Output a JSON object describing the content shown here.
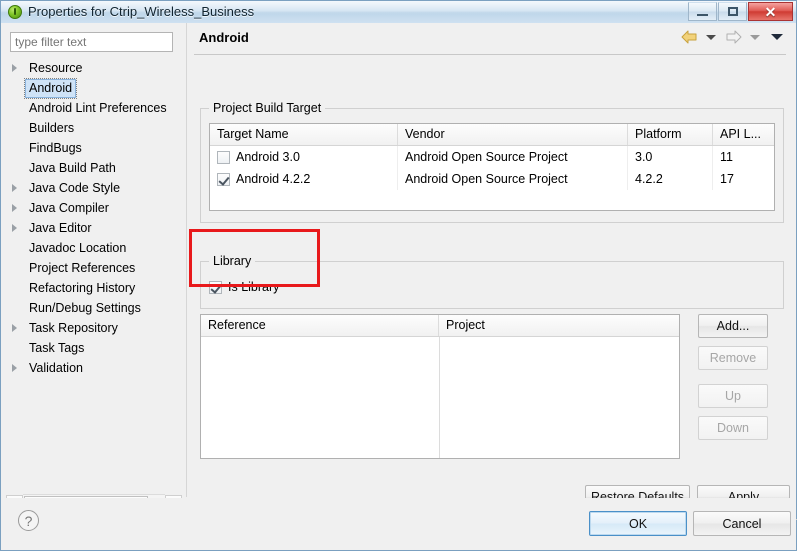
{
  "window": {
    "title": "Properties for Ctrip_Wireless_Business",
    "icon": "eclipse-green-icon",
    "controls": {
      "minimize": "minimize-icon",
      "maximize": "maximize-icon",
      "close": "✕"
    }
  },
  "sidebar": {
    "filter": {
      "value": "",
      "placeholder": "type filter text"
    },
    "items": [
      {
        "label": "Resource",
        "expandable": true,
        "selected": false
      },
      {
        "label": "Android",
        "expandable": false,
        "selected": true
      },
      {
        "label": "Android Lint Preferences",
        "expandable": false,
        "selected": false
      },
      {
        "label": "Builders",
        "expandable": false,
        "selected": false
      },
      {
        "label": "FindBugs",
        "expandable": false,
        "selected": false
      },
      {
        "label": "Java Build Path",
        "expandable": false,
        "selected": false
      },
      {
        "label": "Java Code Style",
        "expandable": true,
        "selected": false
      },
      {
        "label": "Java Compiler",
        "expandable": true,
        "selected": false
      },
      {
        "label": "Java Editor",
        "expandable": true,
        "selected": false
      },
      {
        "label": "Javadoc Location",
        "expandable": false,
        "selected": false
      },
      {
        "label": "Project References",
        "expandable": false,
        "selected": false
      },
      {
        "label": "Refactoring History",
        "expandable": false,
        "selected": false
      },
      {
        "label": "Run/Debug Settings",
        "expandable": false,
        "selected": false
      },
      {
        "label": "Task Repository",
        "expandable": true,
        "selected": false
      },
      {
        "label": "Task Tags",
        "expandable": false,
        "selected": false
      },
      {
        "label": "Validation",
        "expandable": true,
        "selected": false
      }
    ],
    "scrollbar": {
      "left_arrow": "◀",
      "right_arrow": "▶",
      "grip": "❘❘❘"
    }
  },
  "page": {
    "title": "Android",
    "nav": {
      "back": "back-arrow-icon",
      "back_menu": "chevron-down-icon",
      "forward": "forward-arrow-icon",
      "forward_menu": "chevron-down-icon",
      "view_menu": "view-menu-icon"
    }
  },
  "build_target": {
    "group_title": "Project Build Target",
    "columns": [
      "Target Name",
      "Vendor",
      "Platform",
      "API L..."
    ],
    "rows": [
      {
        "checked": false,
        "target_name": "Android 3.0",
        "vendor": "Android Open Source Project",
        "platform": "3.0",
        "api_level": "11"
      },
      {
        "checked": true,
        "target_name": "Android 4.2.2",
        "vendor": "Android Open Source Project",
        "platform": "4.2.2",
        "api_level": "17"
      }
    ]
  },
  "library": {
    "group_title": "Library",
    "is_library": {
      "label": "Is Library",
      "checked": true
    },
    "highlight_color": "#e8191b"
  },
  "references": {
    "columns": [
      "Reference",
      "Project"
    ],
    "rows": [],
    "buttons": [
      {
        "label": "Add...",
        "enabled": true
      },
      {
        "label": "Remove",
        "enabled": false
      },
      {
        "label": "Up",
        "enabled": false
      },
      {
        "label": "Down",
        "enabled": false
      }
    ]
  },
  "footer": {
    "help": "?",
    "restore_defaults": {
      "pre": "Restore ",
      "mnemonic": "D",
      "post": "efaults"
    },
    "apply": {
      "pre": "",
      "mnemonic": "A",
      "post": "pply"
    },
    "ok": "OK",
    "cancel": "Cancel"
  }
}
